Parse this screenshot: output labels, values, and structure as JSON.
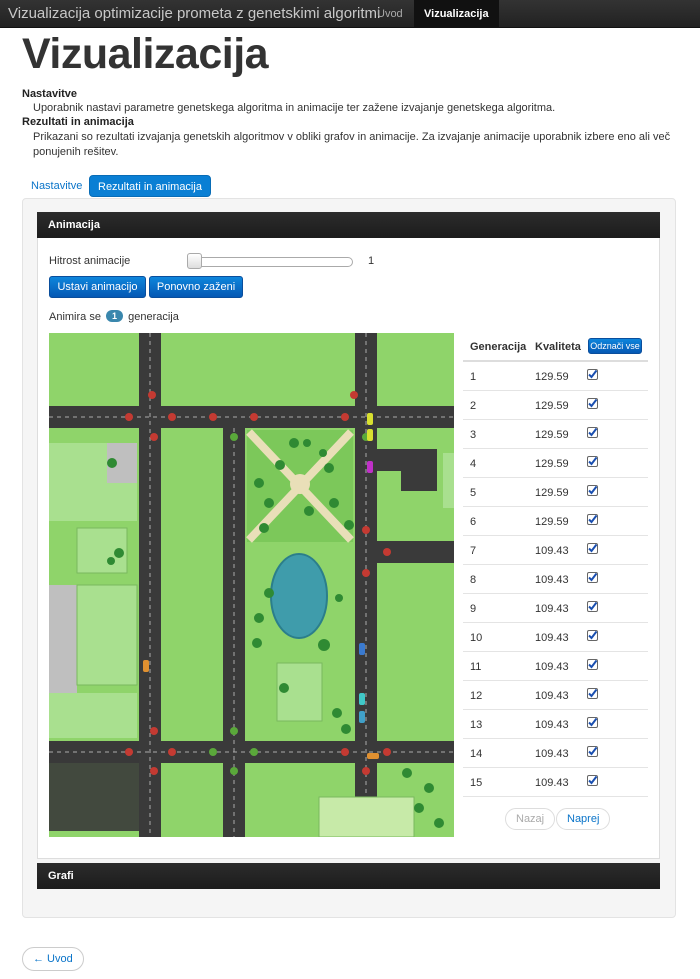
{
  "navbar": {
    "brand": "Vizualizacija optimizacije prometa z genetskimi algoritmi",
    "items": [
      "Uvod",
      "Vizualizacija"
    ]
  },
  "page": {
    "title": "Vizualizacija",
    "settings_heading": "Nastavitve",
    "settings_text": "Uporabnik nastavi parametre genetskega algoritma in animacije ter zažene izvajanje genetskega algoritma.",
    "results_heading": "Rezultati in animacija",
    "results_text": "Prikazani so rezultati izvajanja genetskih algoritmov v obliki grafov in animacije. Za izvajanje animacije uporabnik izbere eno ali več ponujenih rešitev."
  },
  "tabs": [
    "Nastavitve",
    "Rezultati in animacija"
  ],
  "animation_panel": {
    "title": "Animacija",
    "speed_label": "Hitrost animacije",
    "speed_value": "1",
    "speed_level": 0.0,
    "set_button": "Ustavi animacijo",
    "restart_button": "Ponovno zaženi",
    "animating_prefix": "Animira se",
    "animating_count": "1",
    "animating_suffix": "generacija"
  },
  "results_table": {
    "headers": [
      "Generacija",
      "Kvaliteta"
    ],
    "select_all": "Odznači vse",
    "rows": [
      {
        "gen": "1",
        "quality": "129.59",
        "checked": true
      },
      {
        "gen": "2",
        "quality": "129.59",
        "checked": true
      },
      {
        "gen": "3",
        "quality": "129.59",
        "checked": true
      },
      {
        "gen": "4",
        "quality": "129.59",
        "checked": true
      },
      {
        "gen": "5",
        "quality": "129.59",
        "checked": true
      },
      {
        "gen": "6",
        "quality": "129.59",
        "checked": true
      },
      {
        "gen": "7",
        "quality": "109.43",
        "checked": true
      },
      {
        "gen": "8",
        "quality": "109.43",
        "checked": true
      },
      {
        "gen": "9",
        "quality": "109.43",
        "checked": true
      },
      {
        "gen": "10",
        "quality": "109.43",
        "checked": true
      },
      {
        "gen": "11",
        "quality": "109.43",
        "checked": true
      },
      {
        "gen": "12",
        "quality": "109.43",
        "checked": true
      },
      {
        "gen": "13",
        "quality": "109.43",
        "checked": true
      },
      {
        "gen": "14",
        "quality": "109.43",
        "checked": true
      },
      {
        "gen": "15",
        "quality": "109.43",
        "checked": true
      }
    ],
    "prev": "Nazaj",
    "next": "Naprej"
  },
  "graphs_panel": {
    "title": "Grafi"
  },
  "back_button": "← Uvod",
  "colors": {
    "grass": "#8fd46a",
    "road": "#3a3a3a",
    "water": "#3f9cab",
    "accent": "#0a7fd4",
    "navbar": "#222222"
  }
}
